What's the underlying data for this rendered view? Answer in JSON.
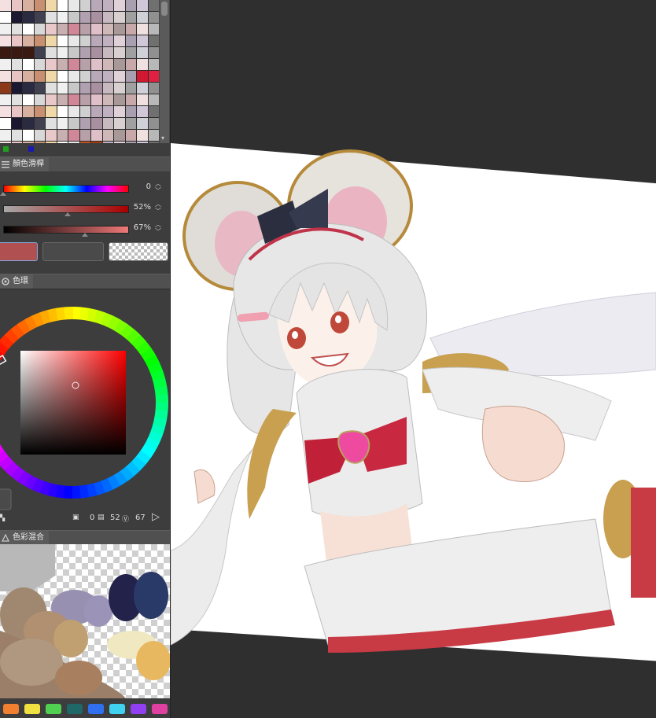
{
  "slider_panel": {
    "tab_label": "顏色滑桿",
    "hue_value": "0",
    "saturation_value": "52%",
    "value_value": "67%"
  },
  "wheel_panel": {
    "tab_label": "色環",
    "h_value": "0",
    "s_value": "52",
    "v_value": "67"
  },
  "mix_panel": {
    "tab_label": "色彩混合"
  },
  "colors": {
    "current_color": "#b05050",
    "secondary_color": "#4a4a4a",
    "panel_bg": "#3d3d3d",
    "canvas_bg": "#2f2f2f"
  },
  "palette": [
    "#f08030",
    "#f0e040",
    "#50d050",
    "#206868",
    "#3070f0",
    "#40d0f0",
    "#9040f0",
    "#e040a0"
  ]
}
